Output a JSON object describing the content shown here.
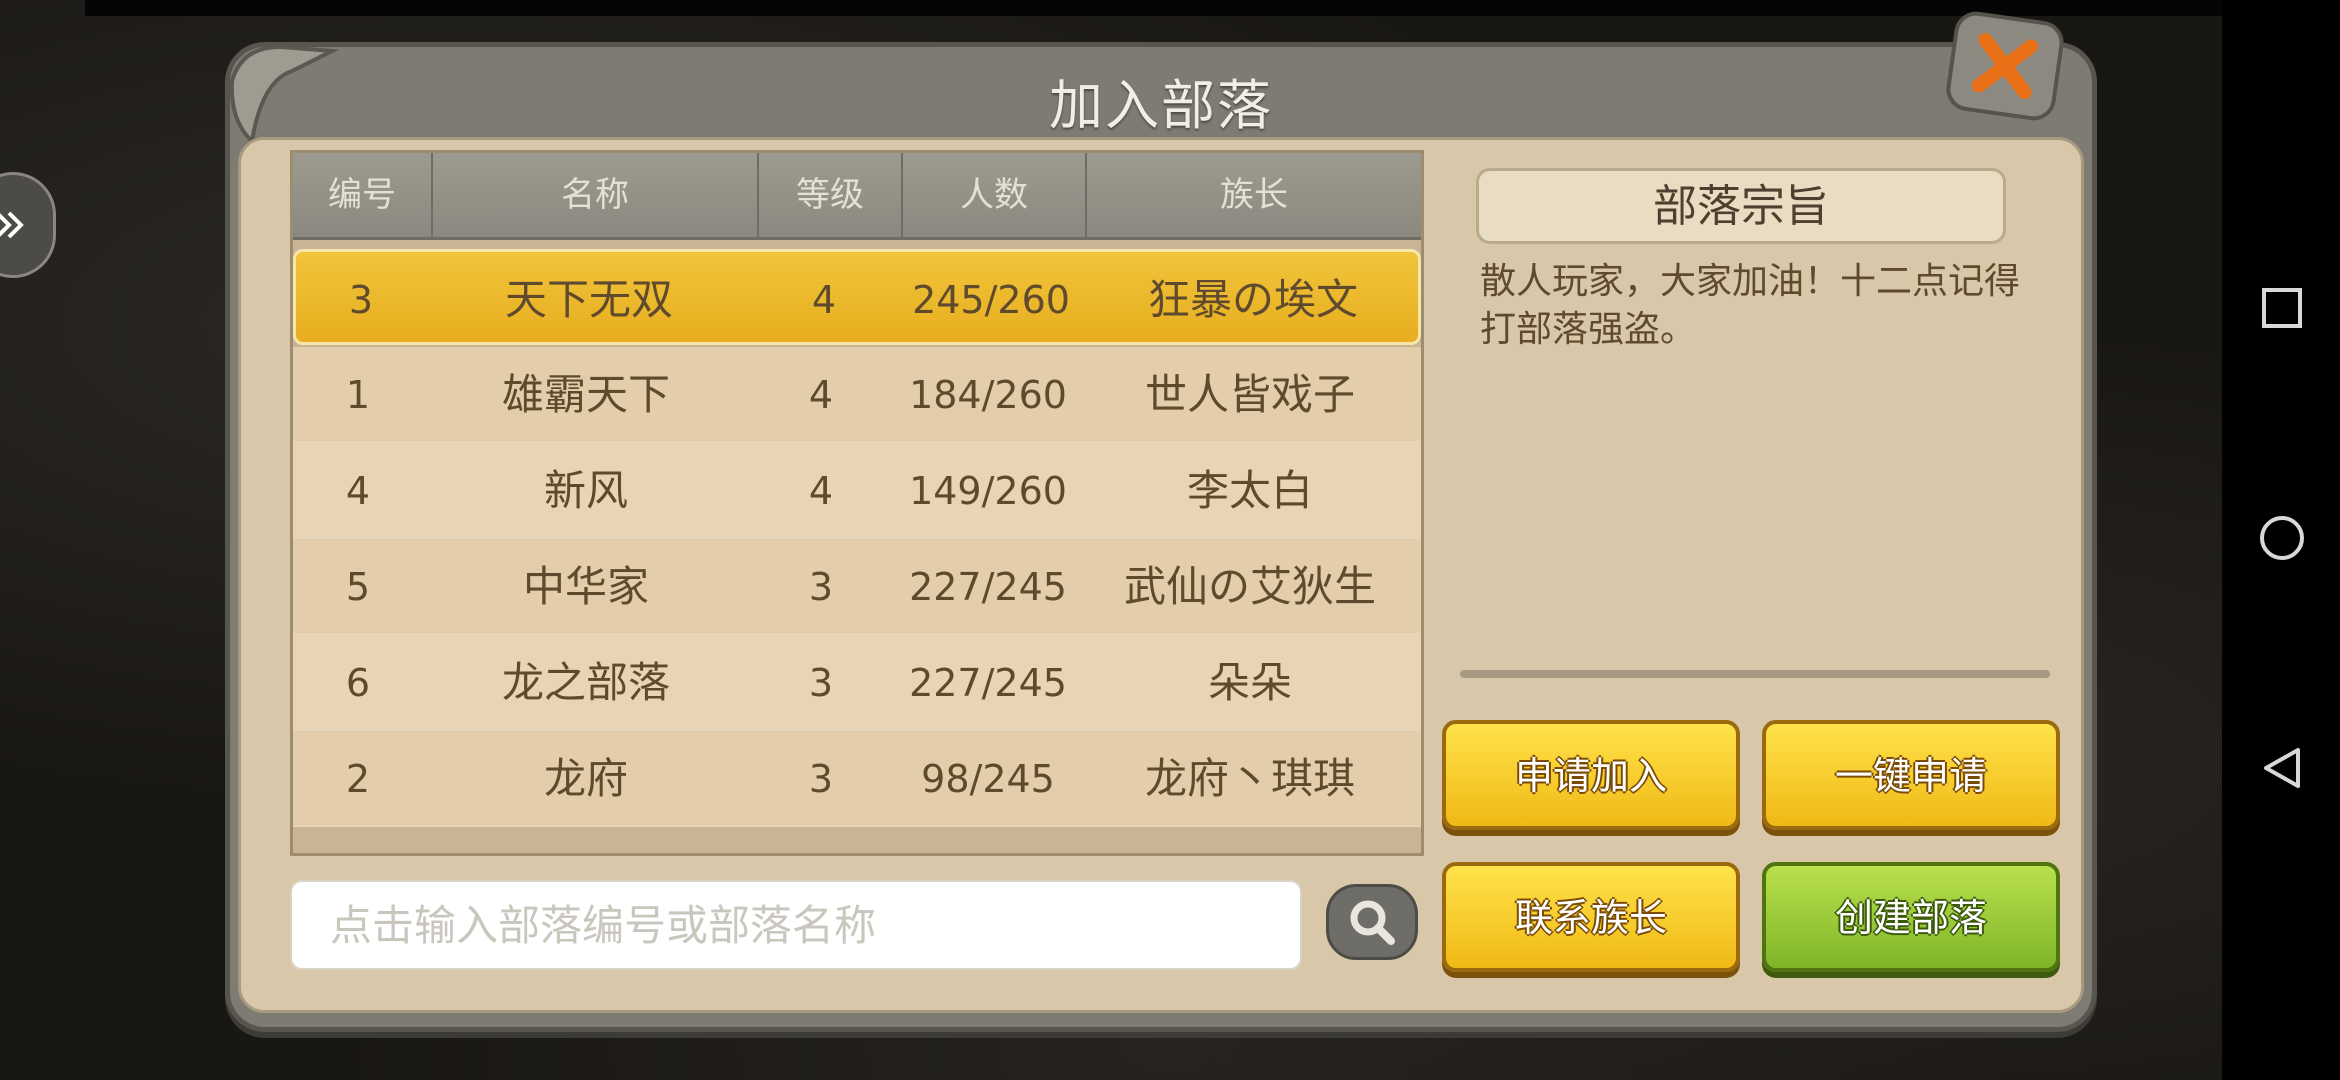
{
  "dialog": {
    "title": "加入部落"
  },
  "table": {
    "columns": [
      "编号",
      "名称",
      "等级",
      "人数",
      "族长"
    ],
    "rows": [
      {
        "id": "3",
        "name": "天下无双",
        "level": "4",
        "members": "245/260",
        "leader": "狂暴の埃文",
        "selected": true
      },
      {
        "id": "1",
        "name": "雄霸天下",
        "level": "4",
        "members": "184/260",
        "leader": "世人皆戏子",
        "selected": false
      },
      {
        "id": "4",
        "name": "新风",
        "level": "4",
        "members": "149/260",
        "leader": "李太白",
        "selected": false
      },
      {
        "id": "5",
        "name": "中华家",
        "level": "3",
        "members": "227/245",
        "leader": "武仙の艾狄生",
        "selected": false
      },
      {
        "id": "6",
        "name": "龙之部落",
        "level": "3",
        "members": "227/245",
        "leader": "朵朵",
        "selected": false
      },
      {
        "id": "2",
        "name": "龙府",
        "level": "3",
        "members": "98/245",
        "leader": "龙府丶琪琪",
        "selected": false
      }
    ]
  },
  "search": {
    "placeholder": "点击输入部落编号或部落名称",
    "value": ""
  },
  "info": {
    "title": "部落宗旨",
    "text": "散人玩家，大家加油！十二点记得打部落强盗。"
  },
  "buttons": {
    "apply": "申请加入",
    "one_click_apply": "一键申请",
    "contact_leader": "联系族长",
    "create_tribe": "创建部落"
  },
  "colors": {
    "selected_row": "#e7ae1f",
    "yellow_button": "#f0b915",
    "green_button": "#7fb528",
    "close_x": "#e96f16"
  },
  "icons": {
    "close": "close-icon",
    "search": "search-icon",
    "side_handle": "double-chevron-right-icon",
    "nav_recent": "square-icon",
    "nav_home": "circle-icon",
    "nav_back": "triangle-back-icon"
  }
}
